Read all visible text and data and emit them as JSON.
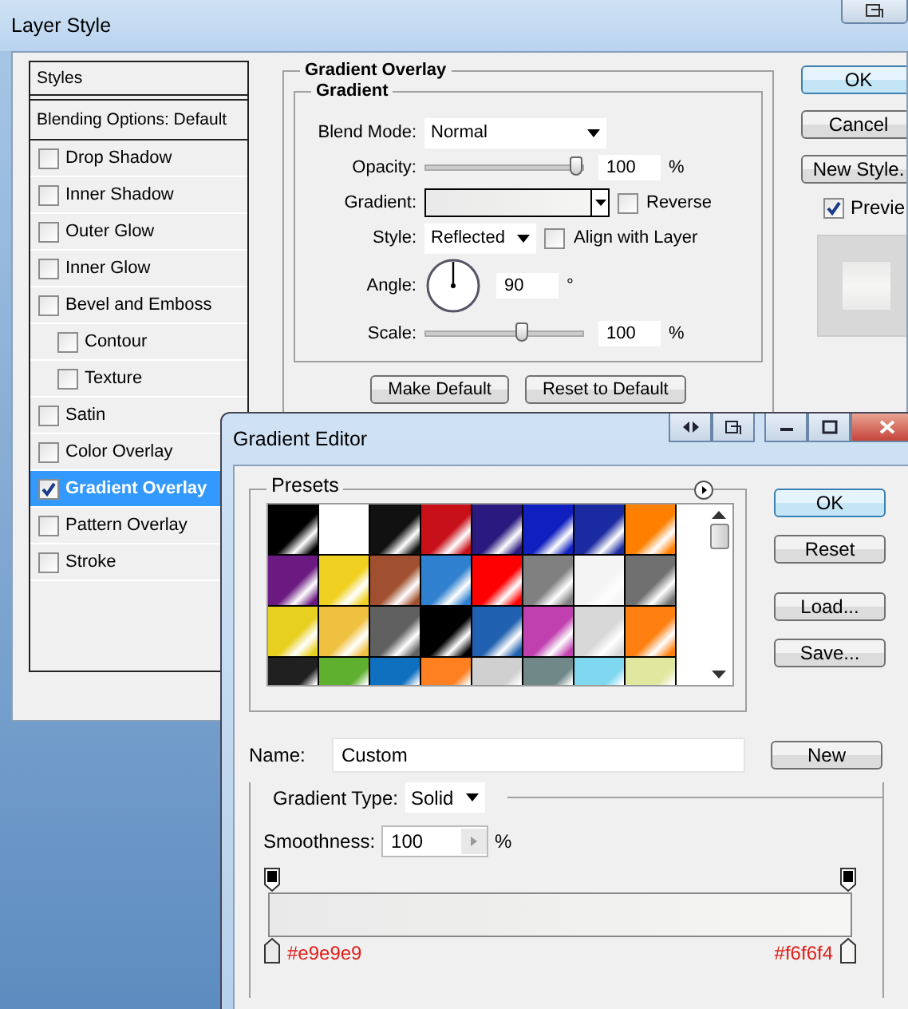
{
  "layer_style": {
    "title": "Layer Style",
    "styles_header": "Styles",
    "blending_options": "Blending Options: Default",
    "styles": [
      {
        "label": "Drop Shadow",
        "checked": false,
        "selected": false
      },
      {
        "label": "Inner Shadow",
        "checked": false,
        "selected": false
      },
      {
        "label": "Outer Glow",
        "checked": false,
        "selected": false
      },
      {
        "label": "Inner Glow",
        "checked": false,
        "selected": false
      },
      {
        "label": "Bevel and Emboss",
        "checked": false,
        "selected": false,
        "children": [
          {
            "label": "Contour",
            "checked": false,
            "selected": false
          },
          {
            "label": "Texture",
            "checked": false,
            "selected": false
          }
        ]
      },
      {
        "label": "Satin",
        "checked": false,
        "selected": false
      },
      {
        "label": "Color Overlay",
        "checked": false,
        "selected": false
      },
      {
        "label": "Gradient Overlay",
        "checked": true,
        "selected": true
      },
      {
        "label": "Pattern Overlay",
        "checked": false,
        "selected": false
      },
      {
        "label": "Stroke",
        "checked": false,
        "selected": false
      }
    ],
    "panel": {
      "title": "Gradient Overlay",
      "group": "Gradient",
      "blend_mode": {
        "label": "Blend Mode:",
        "value": "Normal"
      },
      "opacity": {
        "label": "Opacity:",
        "level": 1,
        "value": "100",
        "unit": "%"
      },
      "gradient": {
        "label": "Gradient:"
      },
      "reverse": {
        "label": "Reverse",
        "checked": false
      },
      "style": {
        "label": "Style:",
        "value": "Reflected"
      },
      "align": {
        "label": "Align with Layer",
        "checked": false
      },
      "angle": {
        "label": "Angle:",
        "value": "90",
        "unit": "°"
      },
      "scale": {
        "label": "Scale:",
        "level": 0.62,
        "value": "100",
        "unit": "%"
      },
      "buttons": [
        "Make Default",
        "Reset to Default"
      ]
    },
    "buttons": [
      {
        "label": "OK",
        "default": true
      },
      {
        "label": "Cancel",
        "default": false
      },
      {
        "label": "New Style.",
        "default": false
      }
    ],
    "preview": {
      "label": "Previe",
      "checked": true
    }
  },
  "gradient_editor": {
    "title": "Gradient Editor",
    "presets_label": "Presets",
    "presets": [
      {
        "color": "#000000"
      },
      {
        "color": "#ffffff"
      },
      {
        "color": "#111111"
      },
      {
        "color": "#c8101a"
      },
      {
        "color": "#2a1a80"
      },
      {
        "color": "#1020c0"
      },
      {
        "color": "#1a2aa0"
      },
      {
        "color": "#ff8000"
      },
      {
        "color": "#6a1a80"
      },
      {
        "color": "#f0d020"
      },
      {
        "color": "#a05030"
      },
      {
        "color": "#3080d0"
      },
      {
        "color": "#ff0000"
      },
      {
        "color": "#808080"
      },
      {
        "color": "#f4f4f4"
      },
      {
        "color": "#707070"
      },
      {
        "color": "#e8d020"
      },
      {
        "color": "#f0c040"
      },
      {
        "color": "#606060"
      },
      {
        "color": "#000000"
      },
      {
        "color": "#2060b0"
      },
      {
        "color": "#c040b0"
      },
      {
        "color": "#d8d8d8"
      },
      {
        "color": "#ff8010"
      },
      {
        "color": "#202020"
      },
      {
        "color": "#60b030"
      },
      {
        "color": "#1070c0"
      },
      {
        "color": "#ff8020"
      },
      {
        "color": "#d0d0d0"
      },
      {
        "color": "#708888"
      },
      {
        "color": "#80d8f0"
      },
      {
        "color": "#e0e8a0"
      }
    ],
    "buttons": [
      {
        "label": "OK",
        "default": true
      },
      {
        "label": "Reset",
        "default": false
      },
      {
        "label": "Load...",
        "default": false
      },
      {
        "label": "Save...",
        "default": false
      }
    ],
    "name": {
      "label": "Name:",
      "value": "Custom"
    },
    "new_button": "New",
    "gradient_type": {
      "label": "Gradient Type:",
      "value": "Solid"
    },
    "smoothness": {
      "label": "Smoothness:",
      "value": "100",
      "unit": "%"
    },
    "color_stops": [
      {
        "label": "#e9e9e9",
        "color": "#e9e9e9"
      },
      {
        "label": "#f6f6f4",
        "color": "#f6f6f4"
      }
    ]
  }
}
